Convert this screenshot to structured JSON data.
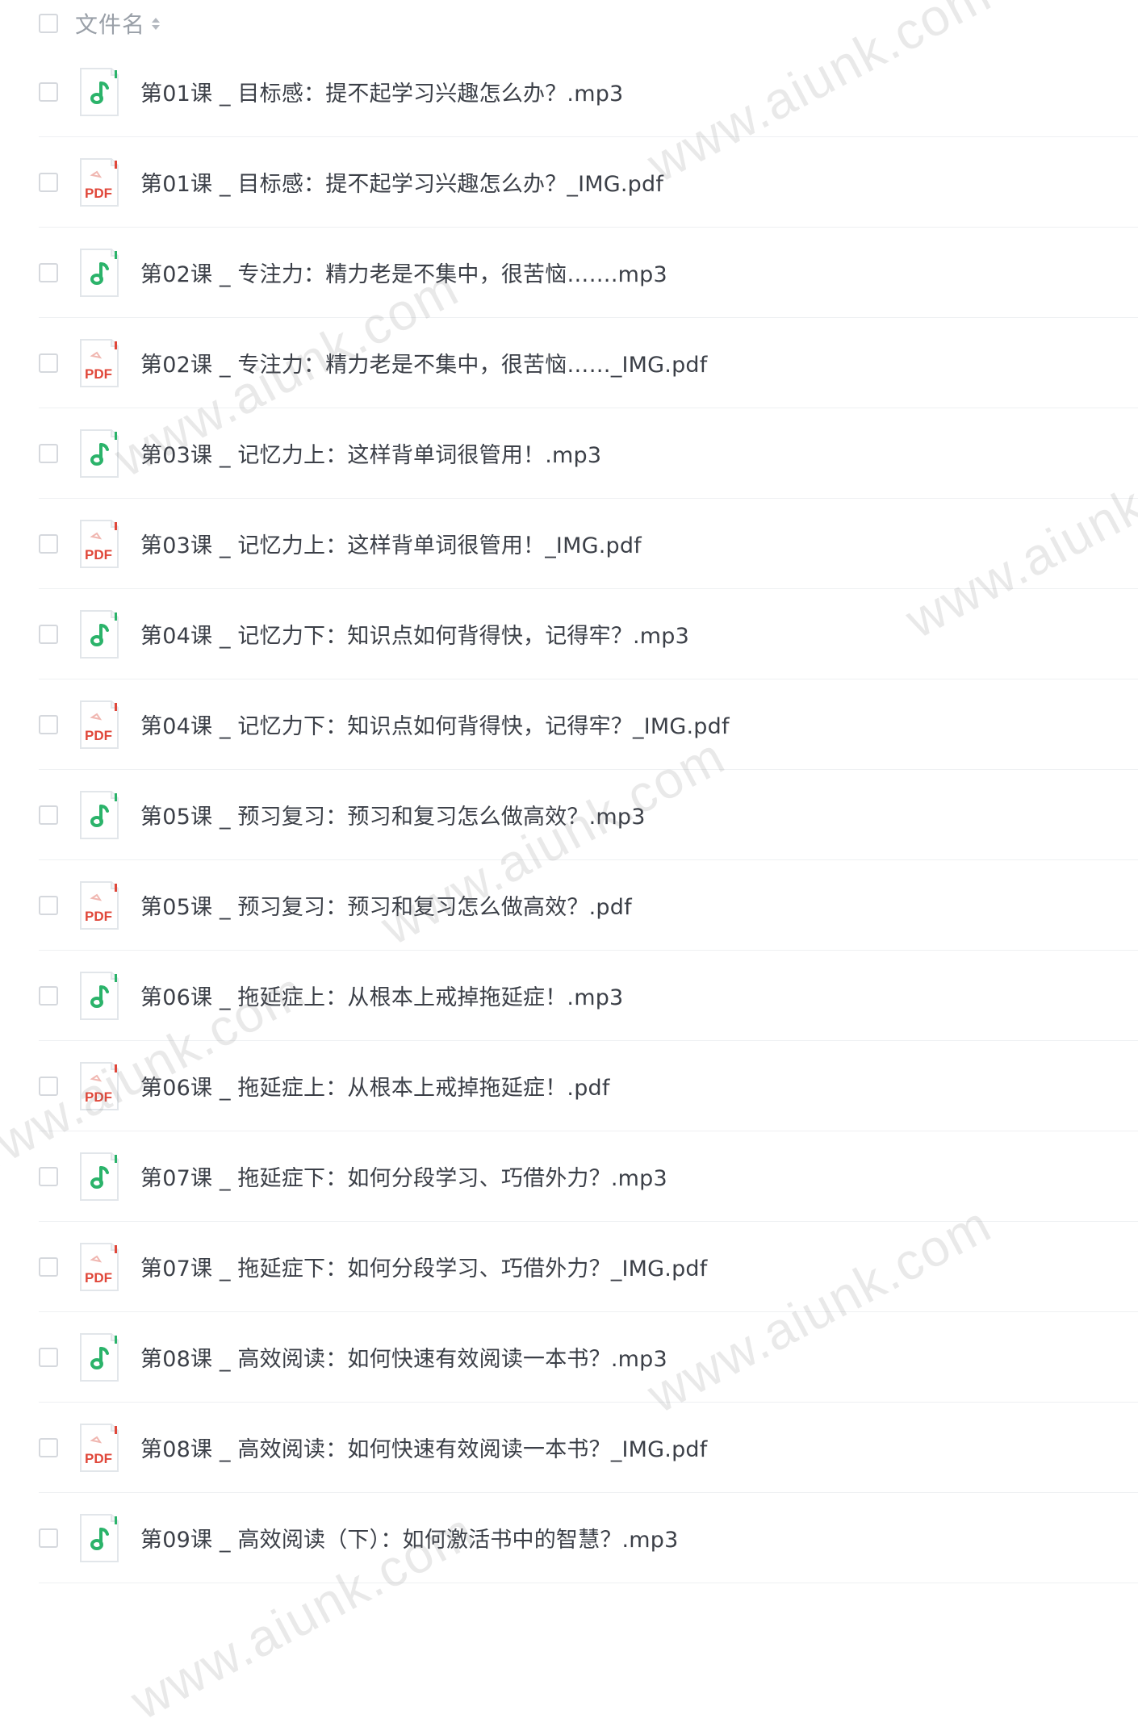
{
  "header": {
    "column_label": "文件名"
  },
  "files": [
    {
      "name": "第01课 _ 目标感：提不起学习兴趣怎么办？.mp3",
      "type": "audio"
    },
    {
      "name": "第01课 _ 目标感：提不起学习兴趣怎么办？_IMG.pdf",
      "type": "pdf"
    },
    {
      "name": "第02课 _ 专注力：精力老是不集中，很苦恼…….mp3",
      "type": "audio"
    },
    {
      "name": "第02课 _ 专注力：精力老是不集中，很苦恼……_IMG.pdf",
      "type": "pdf"
    },
    {
      "name": "第03课 _ 记忆力上：这样背单词很管用！.mp3",
      "type": "audio"
    },
    {
      "name": "第03课 _ 记忆力上：这样背单词很管用！_IMG.pdf",
      "type": "pdf"
    },
    {
      "name": "第04课 _ 记忆力下：知识点如何背得快，记得牢？.mp3",
      "type": "audio"
    },
    {
      "name": "第04课 _ 记忆力下：知识点如何背得快，记得牢？_IMG.pdf",
      "type": "pdf"
    },
    {
      "name": "第05课 _ 预习复习：预习和复习怎么做高效？.mp3",
      "type": "audio"
    },
    {
      "name": "第05课 _ 预习复习：预习和复习怎么做高效？.pdf",
      "type": "pdf"
    },
    {
      "name": "第06课 _ 拖延症上：从根本上戒掉拖延症！.mp3",
      "type": "audio"
    },
    {
      "name": "第06课 _ 拖延症上：从根本上戒掉拖延症！.pdf",
      "type": "pdf"
    },
    {
      "name": "第07课 _ 拖延症下：如何分段学习、巧借外力？.mp3",
      "type": "audio"
    },
    {
      "name": "第07课 _ 拖延症下：如何分段学习、巧借外力？_IMG.pdf",
      "type": "pdf"
    },
    {
      "name": "第08课 _ 高效阅读：如何快速有效阅读一本书？.mp3",
      "type": "audio"
    },
    {
      "name": "第08课 _ 高效阅读：如何快速有效阅读一本书？_IMG.pdf",
      "type": "pdf"
    },
    {
      "name": "第09课 _ 高效阅读（下）：如何激活书中的智慧？.mp3",
      "type": "audio"
    }
  ],
  "icons": {
    "audio": "music-note-icon",
    "pdf": "pdf-file-icon",
    "pdf_badge": "PDF"
  },
  "watermark": {
    "text": "www.aiunk.com"
  },
  "colors": {
    "audio_accent": "#2bb36a",
    "pdf_accent": "#e0473a",
    "text": "#3b3f47",
    "header_text": "#9aa0a8",
    "divider": "#eef0f2"
  }
}
